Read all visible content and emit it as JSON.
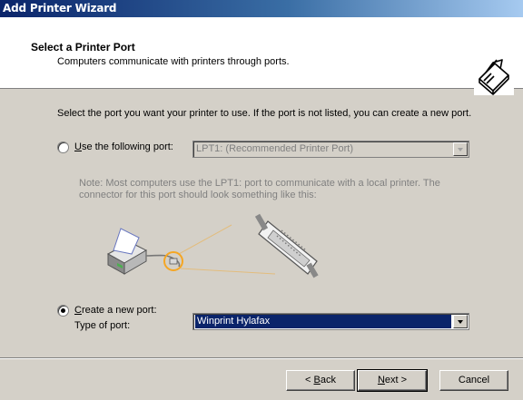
{
  "window": {
    "title": "Add Printer Wizard"
  },
  "header": {
    "title": "Select a Printer Port",
    "subtitle": "Computers communicate with printers through ports."
  },
  "body": {
    "intro": "Select the port you want your printer to use.  If the port is not listed, you can create a new port.",
    "use_port": {
      "label_prefix": "",
      "label_mnemonic": "U",
      "label_rest": "se the following port:",
      "selected": false,
      "value": "LPT1: (Recommended Printer Port)"
    },
    "note": "Note: Most computers use the LPT1: port to communicate with a local printer. The connector for this port should look something like this:",
    "create_port": {
      "label_mnemonic": "C",
      "label_rest": "reate a new port:",
      "selected": true,
      "type_label": "Type of port:",
      "value": "Winprint Hylafax"
    }
  },
  "buttons": {
    "back": {
      "prefix": "< ",
      "mnemonic": "B",
      "rest": "ack"
    },
    "next": {
      "mnemonic": "N",
      "rest": "ext >"
    },
    "cancel": "Cancel"
  },
  "icons": {
    "header": "printer-wizard-icon",
    "illustration": "printer-port-connector-illustration"
  }
}
